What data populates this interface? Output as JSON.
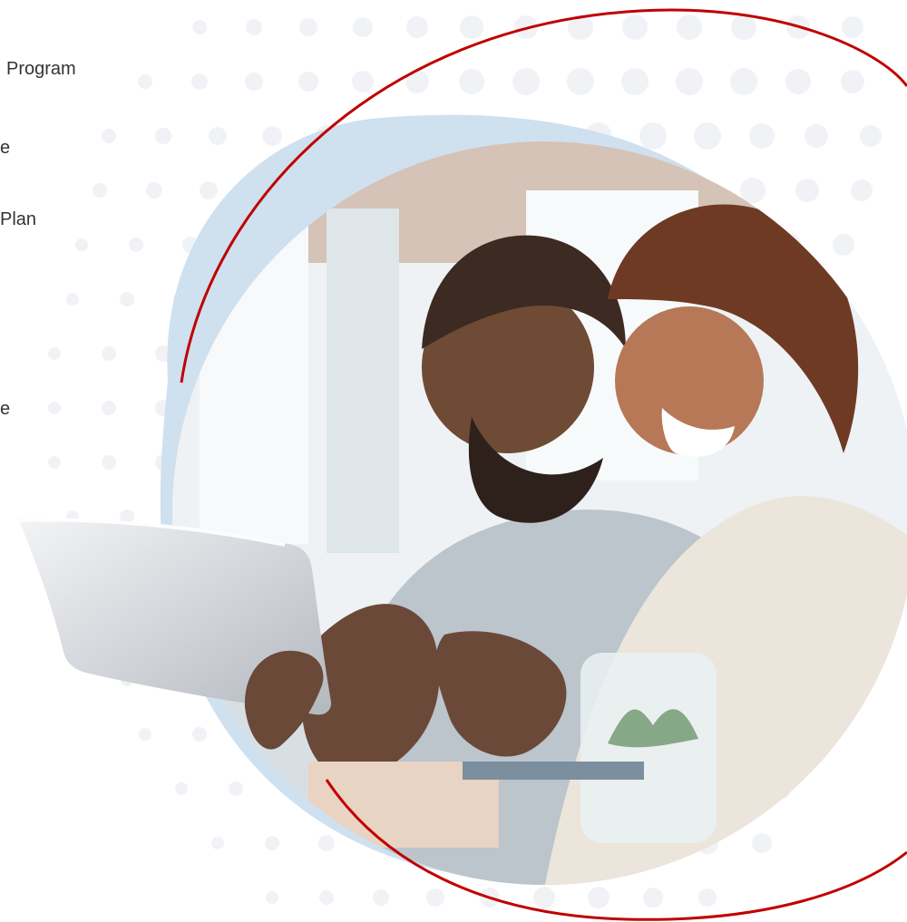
{
  "left_panel": {
    "item_1": "Program",
    "item_2": "e",
    "item_3": "Plan",
    "item_4": "e"
  },
  "colors": {
    "accent_ring": "#c00000",
    "light_blue": "#cfe0ef",
    "dot": "#f0f2f6",
    "text": "#333333"
  },
  "hero": {
    "subject": "couple looking at tablet",
    "icon": "photo-icon"
  }
}
